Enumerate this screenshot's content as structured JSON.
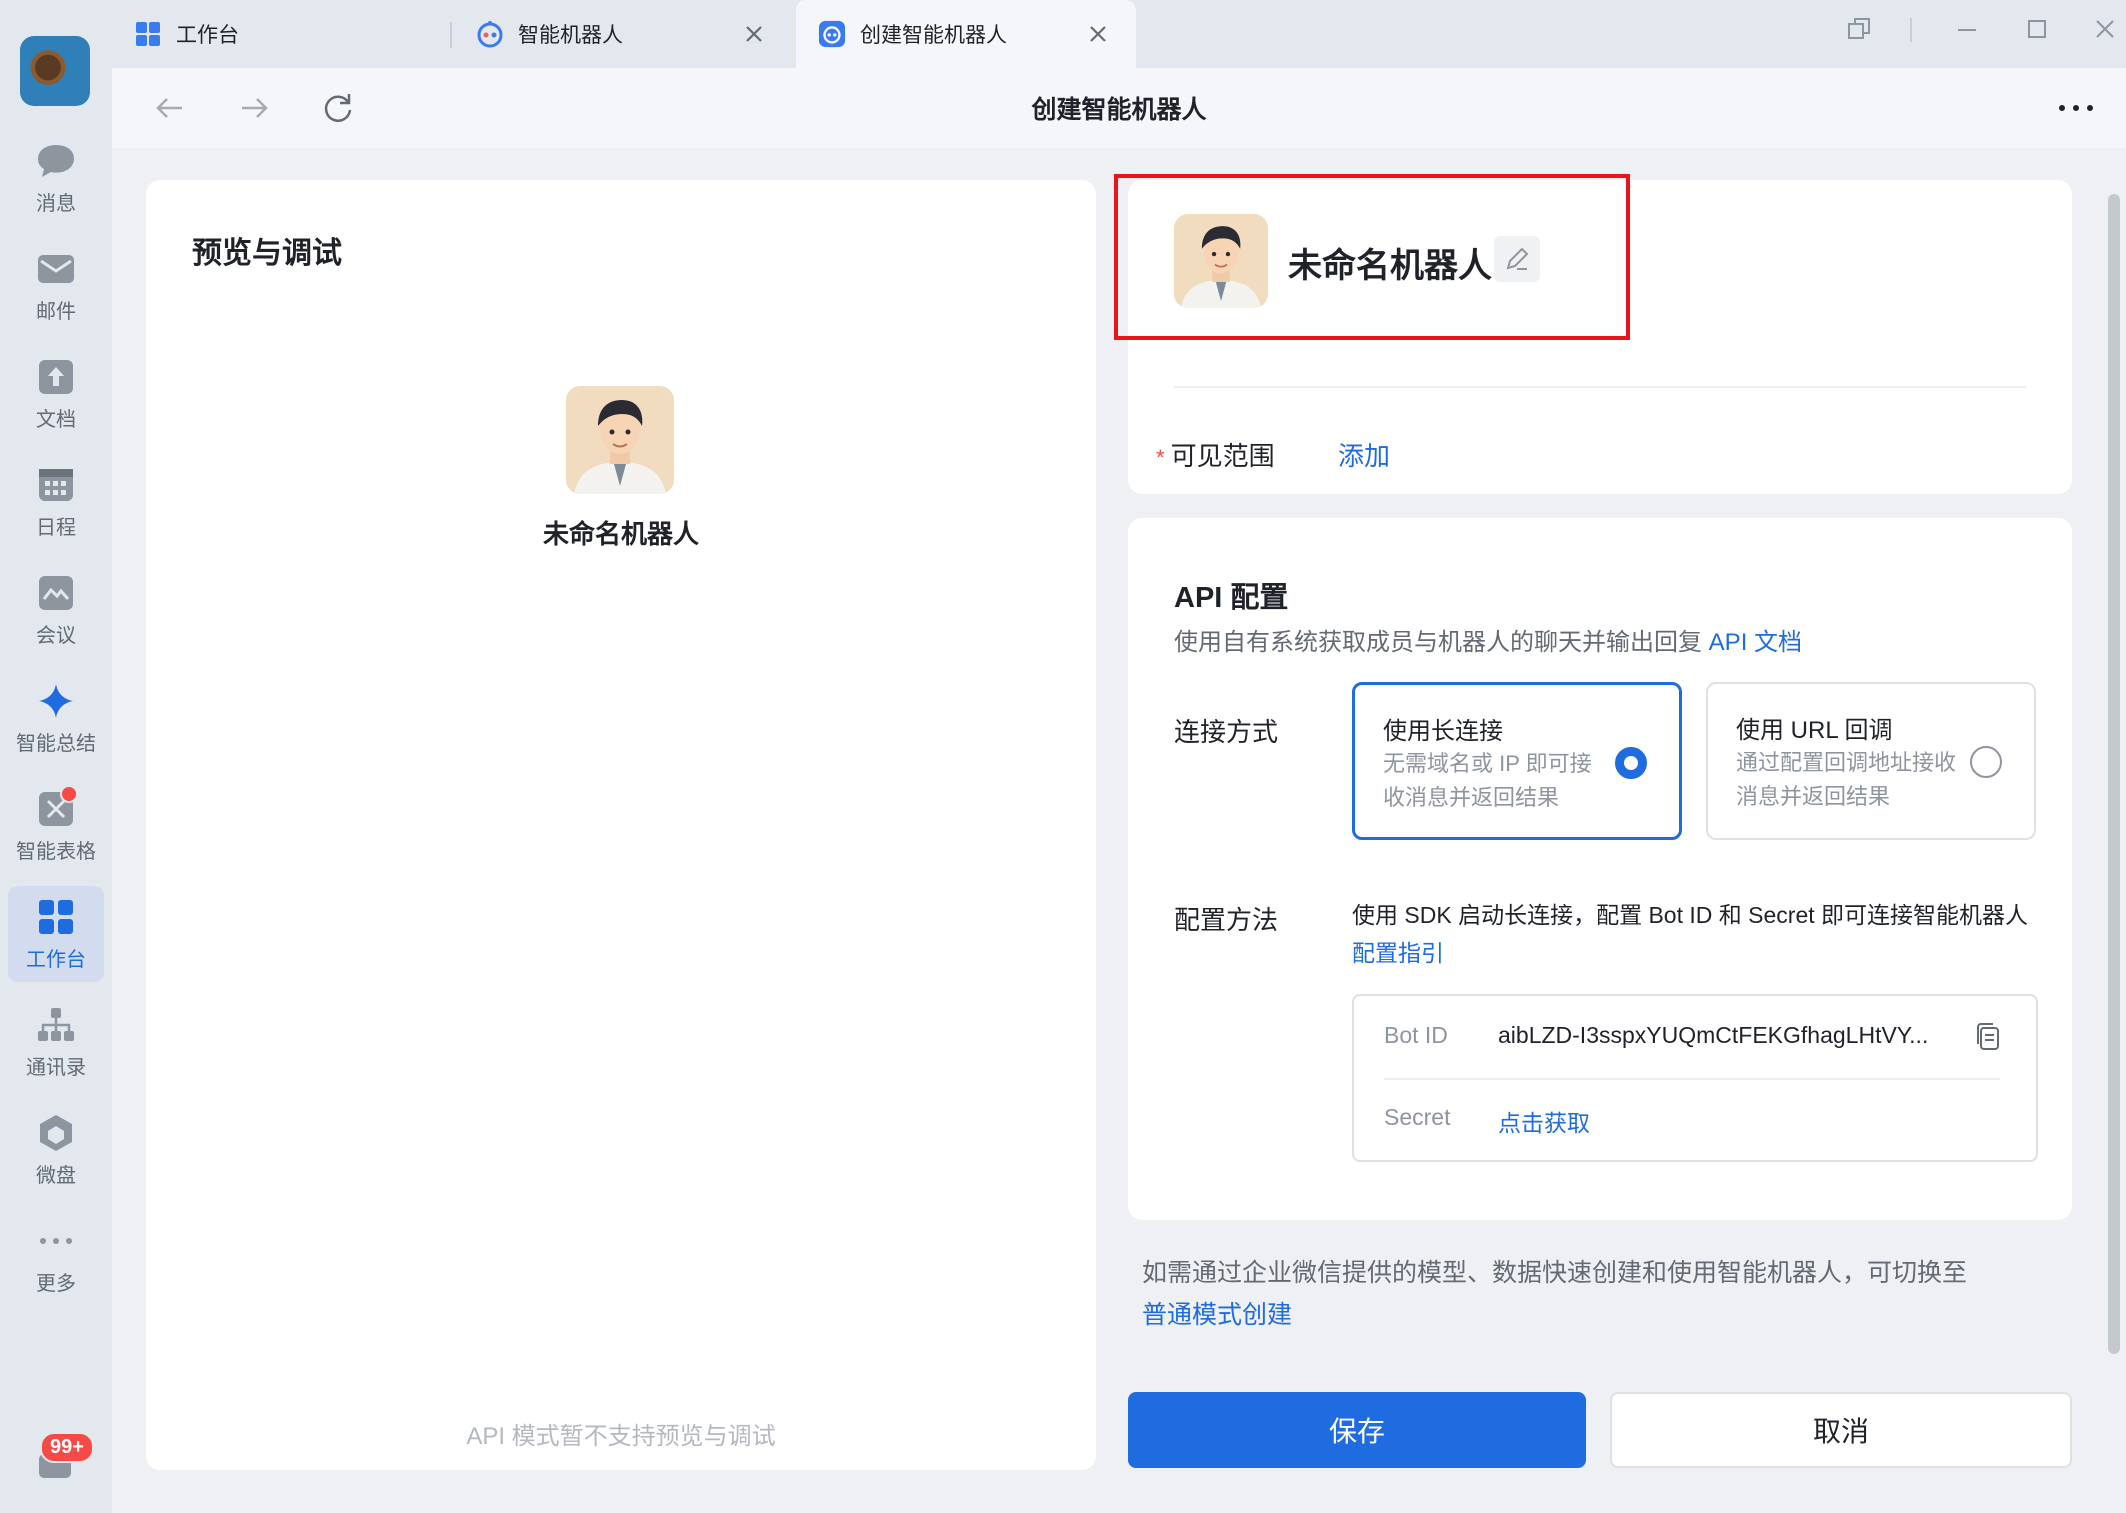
{
  "sidebar": {
    "items": [
      {
        "label": "消息",
        "icon": "chat-bubble-icon"
      },
      {
        "label": "邮件",
        "icon": "mail-icon"
      },
      {
        "label": "文档",
        "icon": "doc-icon"
      },
      {
        "label": "日程",
        "icon": "calendar-icon"
      },
      {
        "label": "会议",
        "icon": "meeting-icon"
      },
      {
        "label": "智能总结",
        "icon": "sparkle-icon"
      },
      {
        "label": "智能表格",
        "icon": "smart-sheet-icon"
      },
      {
        "label": "工作台",
        "icon": "workbench-grid-icon"
      },
      {
        "label": "通讯录",
        "icon": "org-chart-icon"
      },
      {
        "label": "微盘",
        "icon": "drive-icon"
      },
      {
        "label": "更多",
        "icon": "more-dots-icon"
      }
    ],
    "active": "工作台",
    "badge": "99+"
  },
  "tabs": [
    {
      "label": "工作台",
      "icon": "workbench-grid-icon"
    },
    {
      "label": "智能机器人",
      "icon": "robot-icon"
    },
    {
      "label": "创建智能机器人",
      "icon": "robot-icon"
    }
  ],
  "address_bar": {
    "title": "创建智能机器人"
  },
  "preview": {
    "title": "预览与调试",
    "bot_name": "未命名机器人",
    "note": "API 模式暂不支持预览与调试"
  },
  "bot": {
    "name": "未命名机器人",
    "visibility_label": "可见范围",
    "required_mark": "*",
    "visibility_action": "添加"
  },
  "api": {
    "title": "API 配置",
    "desc": "使用自有系统获取成员与机器人的聊天并输出回复",
    "doc_link": "API 文档",
    "connection_label": "连接方式",
    "options": [
      {
        "title": "使用长连接",
        "sub": "无需域名或 IP 即可接收消息并返回结果",
        "selected": true
      },
      {
        "title": "使用 URL 回调",
        "sub": "通过配置回调地址接收消息并返回结果",
        "selected": false
      }
    ],
    "method_label": "配置方法",
    "method_text": "使用 SDK 启动长连接，配置 Bot ID 和 Secret 即可连接智能机器人",
    "method_link": "配置指引",
    "bot_id_key": "Bot ID",
    "bot_id_value": "aibLZD-I3sspxYUQmCtFEKGfhagLHtVY...",
    "secret_key": "Secret",
    "secret_action": "点击获取"
  },
  "switch_note": {
    "text": "如需通过企业微信提供的模型、数据快速创建和使用智能机器人，可切换至",
    "link": "普通模式创建"
  },
  "actions": {
    "save": "保存",
    "cancel": "取消"
  },
  "colors": {
    "accent": "#1f6be0",
    "highlight_frame": "#e8161a"
  }
}
